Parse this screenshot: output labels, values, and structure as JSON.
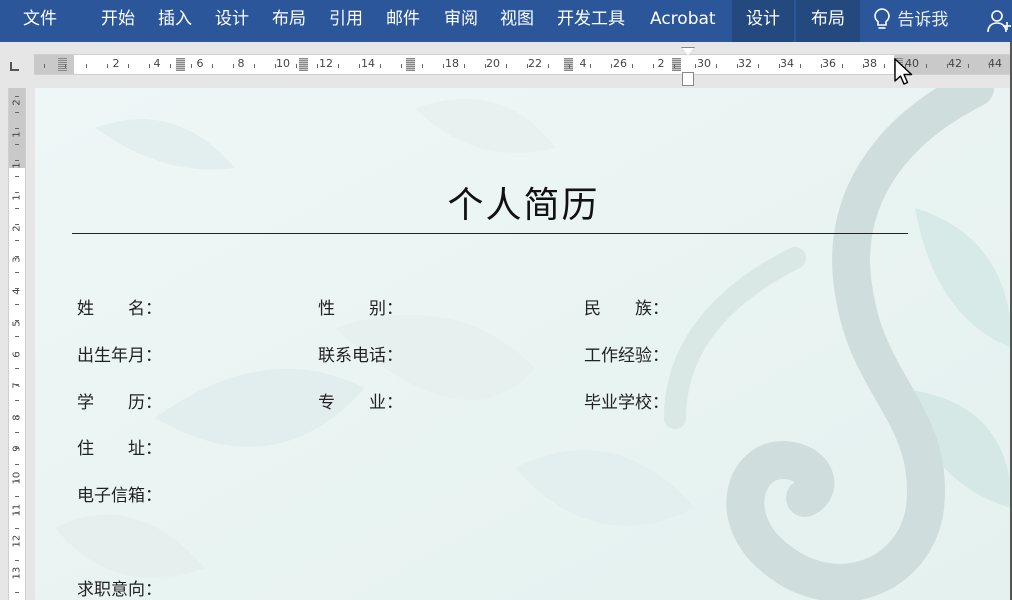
{
  "ribbon": {
    "tabs": [
      {
        "label": "文件"
      },
      {
        "label": "开始"
      },
      {
        "label": "插入"
      },
      {
        "label": "设计"
      },
      {
        "label": "布局"
      },
      {
        "label": "引用"
      },
      {
        "label": "邮件"
      },
      {
        "label": "审阅"
      },
      {
        "label": "视图"
      },
      {
        "label": "开发工具"
      },
      {
        "label": "Acrobat"
      },
      {
        "label": "设计"
      },
      {
        "label": "布局"
      }
    ],
    "tell_me": "告诉我",
    "colors": {
      "ribbon": "#2b579a",
      "context_tab": "#24497f"
    }
  },
  "ruler": {
    "h_labels": [
      "2",
      "4",
      "6",
      "8",
      "10",
      "12",
      "14",
      "18",
      "20",
      "22",
      "4",
      "26",
      "2",
      "30",
      "32",
      "34",
      "36",
      "38",
      "40",
      "42",
      "44"
    ],
    "v_labels": [
      "2",
      "1",
      "1",
      "1",
      "2",
      "3",
      "4",
      "5",
      "6",
      "7",
      "8",
      "9",
      "10",
      "11",
      "12",
      "13"
    ]
  },
  "document": {
    "title": "个人简历",
    "fields": {
      "name": "姓　　名：",
      "gender": "性　　别：",
      "ethnicity": "民　　族：",
      "birth": "出生年月：",
      "phone": "联系电话：",
      "experience": "工作经验：",
      "education": "学　　历：",
      "major": "专　　业：",
      "school": "毕业学校：",
      "address": "住　　址：",
      "email": "电子信箱：",
      "objective": "求职意向："
    }
  }
}
